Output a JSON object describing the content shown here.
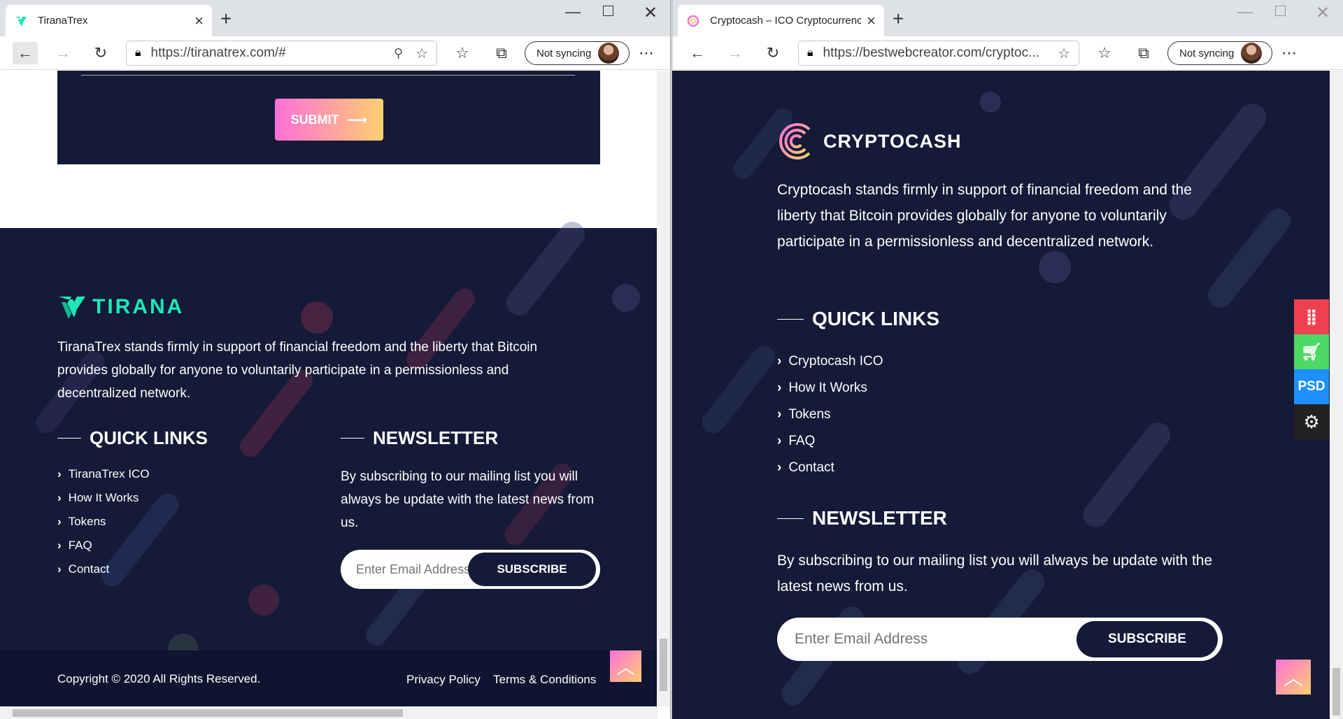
{
  "left": {
    "tab": {
      "title": "TiranaTrex"
    },
    "toolbar": {
      "url": "https://tiranatrex.com/#",
      "sync_label": "Not syncing"
    },
    "form": {
      "submit_label": "SUBMIT"
    },
    "footer": {
      "brand": "TIRANA",
      "description": "TiranaTrex stands firmly in support of financial freedom and the liberty that Bitcoin provides globally for anyone to voluntarily participate in a permissionless and decentralized network.",
      "quick_links": {
        "heading": "QUICK LINKS",
        "items": [
          "TiranaTrex ICO",
          "How It Works",
          "Tokens",
          "FAQ",
          "Contact"
        ]
      },
      "newsletter": {
        "heading": "NEWSLETTER",
        "text": "By subscribing to our mailing list you will always be update with the latest news from us.",
        "placeholder": "Enter Email Address",
        "button": "SUBSCRIBE"
      },
      "copyright": "Copyright © 2020 All Rights Reserved.",
      "privacy": "Privacy Policy",
      "terms": "Terms & Conditions"
    }
  },
  "right": {
    "tab": {
      "title": "Cryptocash – ICO Cryptocurrency"
    },
    "toolbar": {
      "url": "https://bestwebcreator.com/cryptoc...",
      "sync_label": "Not syncing"
    },
    "footer": {
      "brand": "CRYPTOCASH",
      "description": "Cryptocash stands firmly in support of financial freedom and the liberty that Bitcoin provides globally for anyone to voluntarily participate in a permissionless and decentralized network.",
      "quick_links": {
        "heading": "QUICK LINKS",
        "items": [
          "Cryptocash ICO",
          "How It Works",
          "Tokens",
          "FAQ",
          "Contact"
        ]
      },
      "newsletter": {
        "heading": "NEWSLETTER",
        "text": "By subscribing to our mailing list you will always be update with the latest news from us.",
        "placeholder": "Enter Email Address",
        "button": "SUBSCRIBE"
      }
    },
    "side_panel": {
      "psd_label": "PSD",
      "colors": [
        "#f0404f",
        "#4cd964",
        "#1e90ff",
        "#222222"
      ]
    }
  },
  "colors": {
    "footer_bg": "#141a37",
    "tirana_accent": "#1de9b6",
    "gradient_start": "#ff6fd8",
    "gradient_end": "#ffcf6f"
  }
}
